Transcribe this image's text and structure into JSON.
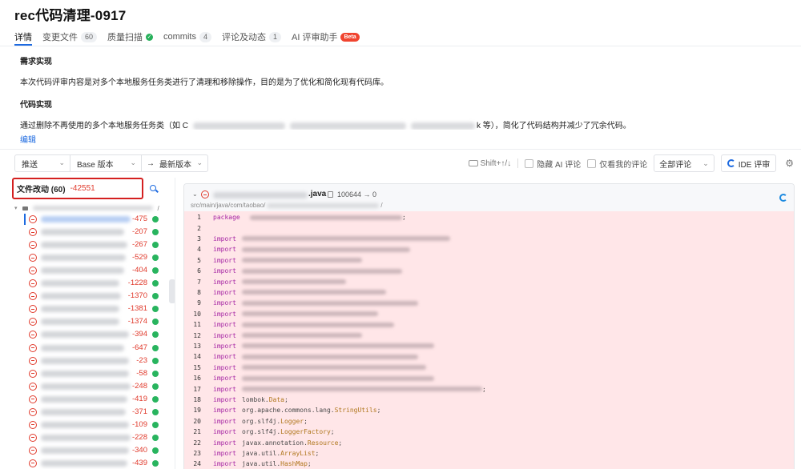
{
  "header": {
    "title": "rec代码清理-0917"
  },
  "tabs": [
    {
      "label": "详情",
      "active": true
    },
    {
      "label": "变更文件",
      "count": "60"
    },
    {
      "label": "质量扫描",
      "status_icon": "check-circle-icon"
    },
    {
      "label": "commits",
      "count": "4"
    },
    {
      "label": "评论及动态",
      "count": "1"
    },
    {
      "label": "AI 评审助手",
      "badge": "Beta"
    }
  ],
  "description": {
    "requirement_heading": "需求实现",
    "requirement_text": "本次代码评审内容是对多个本地服务任务类进行了清理和移除操作，目的是为了优化和简化现有代码库。",
    "code_heading": "代码实现",
    "code_text_prefix": "通过删除不再使用的多个本地服务任务类（如 C",
    "code_text_suffix": "k 等），简化了代码结构并减少了冗余代码。",
    "edit_label": "编辑"
  },
  "toolbar": {
    "push_select": "推送",
    "base_select": "Base 版本",
    "arrow": "→",
    "latest_select": "最新版本",
    "shortcut_hint": "Shift+↑/↓",
    "hide_ai_label": "隐藏 AI 评论",
    "only_mine_label": "仅看我的评论",
    "comments_filter": "全部评论",
    "ide_review_label": "IDE 评审",
    "colors": {
      "accent": "#1d6ae0"
    }
  },
  "file_tree": {
    "filter_label": "文件改动 (60)",
    "total_deletions": "-42551",
    "folder_suffix": "/",
    "files": [
      {
        "deletions": "-475",
        "selected": true
      },
      {
        "deletions": "-207"
      },
      {
        "deletions": "-267"
      },
      {
        "deletions": "-529"
      },
      {
        "deletions": "-404"
      },
      {
        "deletions": "-1228"
      },
      {
        "deletions": "-1370"
      },
      {
        "deletions": "-1381"
      },
      {
        "deletions": "-1374"
      },
      {
        "deletions": "-394"
      },
      {
        "deletions": "-647"
      },
      {
        "deletions": "-23"
      },
      {
        "deletions": "-58"
      },
      {
        "deletions": "-248"
      },
      {
        "deletions": "-419"
      },
      {
        "deletions": "-371"
      },
      {
        "deletions": "-109"
      },
      {
        "deletions": "-228"
      },
      {
        "deletions": "-340"
      },
      {
        "deletions": "-439"
      }
    ],
    "colors": {
      "deletion": "#e0392b",
      "status_ok": "#28b45e"
    }
  },
  "code_view": {
    "file_ext": ".java",
    "mode_change": "100644 → 0",
    "path_prefix": "src/main/java/com/taobao/",
    "path_suffix": "/",
    "lines": [
      {
        "n": "1",
        "kw": "package",
        "text": "",
        "blurred": true,
        "tail": ";"
      },
      {
        "n": "2",
        "kw": "",
        "text": ""
      },
      {
        "n": "3",
        "kw": "import",
        "text": "",
        "blurred": true
      },
      {
        "n": "4",
        "kw": "import",
        "text": "",
        "blurred": true
      },
      {
        "n": "5",
        "kw": "import",
        "text": "",
        "blurred": true
      },
      {
        "n": "6",
        "kw": "import",
        "text": "",
        "blurred": true
      },
      {
        "n": "7",
        "kw": "import",
        "text": "",
        "blurred": true
      },
      {
        "n": "8",
        "kw": "import",
        "text": "",
        "blurred": true
      },
      {
        "n": "9",
        "kw": "import",
        "text": "",
        "blurred": true
      },
      {
        "n": "10",
        "kw": "import",
        "text": "",
        "blurred": true
      },
      {
        "n": "11",
        "kw": "import",
        "text": "",
        "blurred": true
      },
      {
        "n": "12",
        "kw": "import",
        "text": "",
        "blurred": true
      },
      {
        "n": "13",
        "kw": "import",
        "text": "",
        "blurred": true
      },
      {
        "n": "14",
        "kw": "import",
        "text": "",
        "blurred": true
      },
      {
        "n": "15",
        "kw": "import",
        "text": "",
        "blurred": true
      },
      {
        "n": "16",
        "kw": "import",
        "text": "",
        "blurred": true
      },
      {
        "n": "17",
        "kw": "import",
        "text": "",
        "blurred": true,
        "tail": ";"
      },
      {
        "n": "18",
        "kw": "import",
        "pkg": "lombok.",
        "cls": "Data",
        "tail": ";"
      },
      {
        "n": "19",
        "kw": "import",
        "pkg": "org.apache.commons.lang.",
        "cls": "StringUtils",
        "tail": ";"
      },
      {
        "n": "20",
        "kw": "import",
        "pkg": "org.slf4j.",
        "cls": "Logger",
        "tail": ";"
      },
      {
        "n": "21",
        "kw": "import",
        "pkg": "org.slf4j.",
        "cls": "LoggerFactory",
        "tail": ";"
      },
      {
        "n": "22",
        "kw": "import",
        "pkg": "javax.annotation.",
        "cls": "Resource",
        "tail": ";"
      },
      {
        "n": "23",
        "kw": "import",
        "pkg": "java.util.",
        "cls": "ArrayList",
        "tail": ";"
      },
      {
        "n": "24",
        "kw": "import",
        "pkg": "java.util.",
        "cls": "HashMap",
        "tail": ";"
      }
    ],
    "colors": {
      "deleted_bg": "#ffe6e8",
      "keyword": "#a626a4",
      "class": "#b0771d"
    }
  }
}
